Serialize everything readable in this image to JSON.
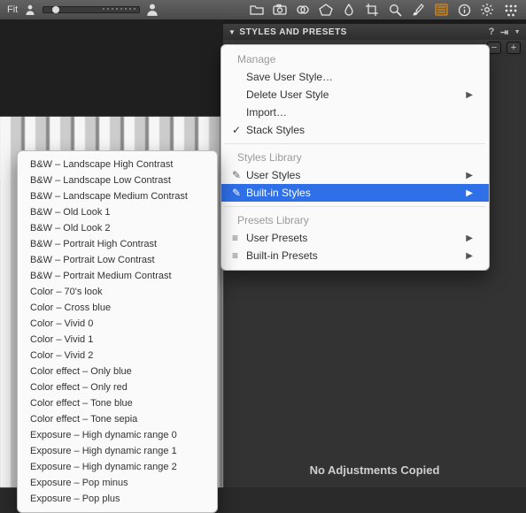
{
  "topbar": {
    "fit": "Fit"
  },
  "panel": {
    "title": "STYLES AND PRESETS",
    "help": "?",
    "footer": "No Adjustments Copied"
  },
  "manage_menu": {
    "heading1": "Manage",
    "save_user_style": "Save User Style…",
    "delete_user_style": "Delete User Style",
    "import": "Import…",
    "stack_styles": "Stack Styles",
    "heading2": "Styles Library",
    "user_styles": "User Styles",
    "built_in_styles": "Built-in Styles",
    "heading3": "Presets Library",
    "user_presets": "User Presets",
    "built_in_presets": "Built-in Presets"
  },
  "styles_list": {
    "i0": "B&W – Landscape High Contrast",
    "i1": "B&W – Landscape Low Contrast",
    "i2": "B&W – Landscape Medium Contrast",
    "i3": "B&W – Old Look 1",
    "i4": "B&W – Old Look 2",
    "i5": "B&W – Portrait High Contrast",
    "i6": "B&W – Portrait Low Contrast",
    "i7": "B&W – Portrait Medium Contrast",
    "i8": "Color – 70's look",
    "i9": "Color – Cross blue",
    "i10": "Color – Vivid 0",
    "i11": "Color – Vivid 1",
    "i12": "Color – Vivid 2",
    "i13": "Color effect – Only blue",
    "i14": "Color effect – Only red",
    "i15": "Color effect – Tone blue",
    "i16": "Color effect – Tone sepia",
    "i17": "Exposure – High dynamic range 0",
    "i18": "Exposure – High dynamic range 1",
    "i19": "Exposure – High dynamic range 2",
    "i20": "Exposure – Pop minus",
    "i21": "Exposure – Pop plus"
  }
}
